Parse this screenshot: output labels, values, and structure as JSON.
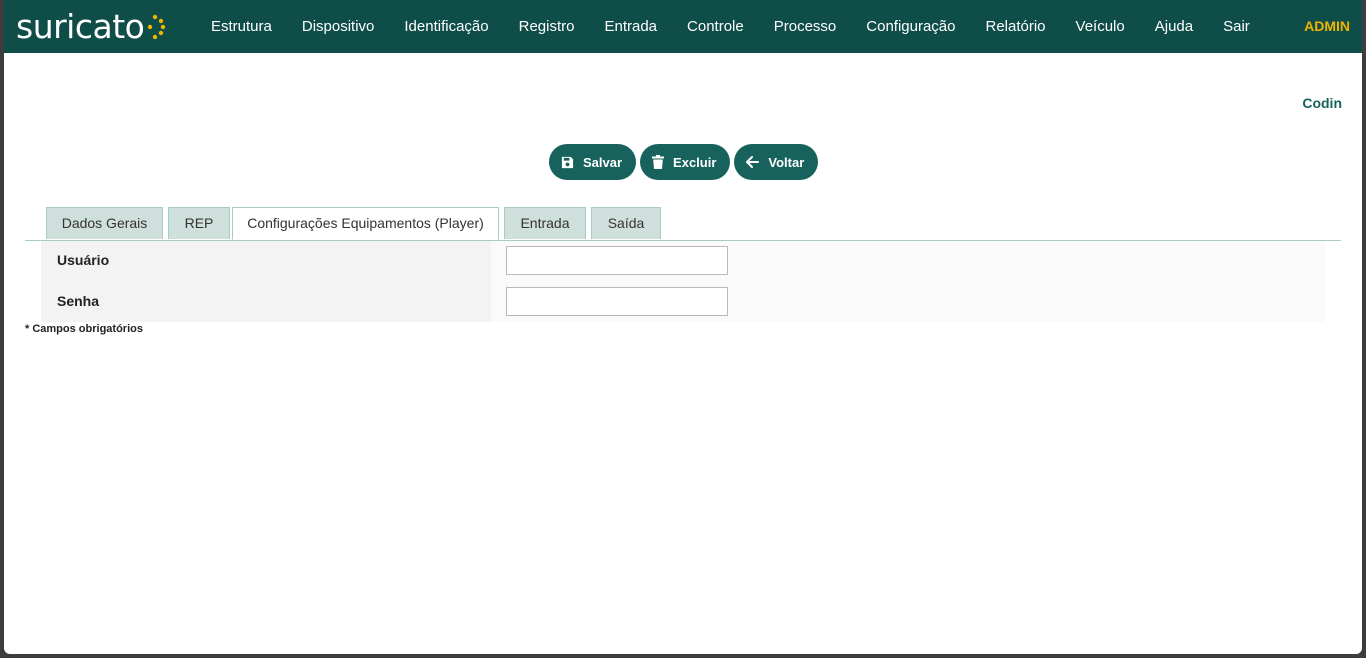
{
  "brand": {
    "logo_text": "suricato",
    "accent_color": "#f0b400",
    "header_color": "#0f4d48",
    "button_color": "#17625c"
  },
  "nav": {
    "items": [
      {
        "label": "Estrutura"
      },
      {
        "label": "Dispositivo"
      },
      {
        "label": "Identificação"
      },
      {
        "label": "Registro"
      },
      {
        "label": "Entrada"
      },
      {
        "label": "Controle"
      },
      {
        "label": "Processo"
      },
      {
        "label": "Configuração"
      },
      {
        "label": "Relatório"
      },
      {
        "label": "Veículo"
      },
      {
        "label": "Ajuda"
      },
      {
        "label": "Sair"
      }
    ],
    "user": "ADMIN"
  },
  "page": {
    "corner_label": "Codin"
  },
  "toolbar": {
    "save_label": "Salvar",
    "save_icon": "floppy-disk-icon",
    "delete_label": "Excluir",
    "delete_icon": "trash-icon",
    "back_label": "Voltar",
    "back_icon": "arrow-left-icon"
  },
  "tabs": [
    {
      "label": "Dados Gerais",
      "active": false
    },
    {
      "label": "REP",
      "active": false
    },
    {
      "label": "Configurações Equipamentos (Player)",
      "active": true
    },
    {
      "label": "Entrada",
      "active": false
    },
    {
      "label": "Saída",
      "active": false
    }
  ],
  "form": {
    "fields": [
      {
        "label": "Usuário",
        "value": ""
      },
      {
        "label": "Senha",
        "value": ""
      }
    ],
    "required_note": "* Campos obrigatórios"
  }
}
